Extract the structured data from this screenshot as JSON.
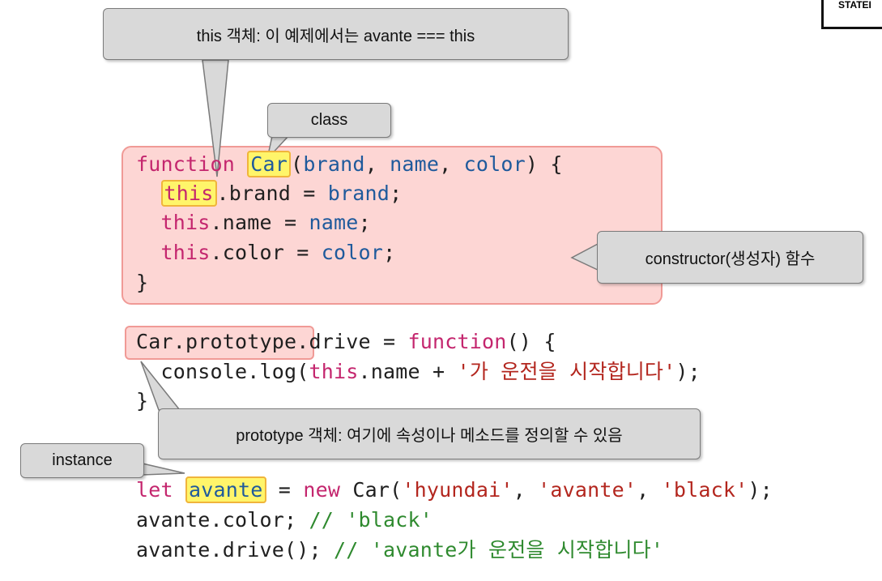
{
  "callouts": {
    "this_object": "this 객체: 이 예제에서는 avante === this",
    "class": "class",
    "constructor": "constructor(생성자) 함수",
    "prototype_object": "prototype 객체: 여기에 속성이나 메소드를 정의할 수 있음",
    "instance": "instance"
  },
  "corner_label": "STATEI",
  "code": {
    "line1": {
      "kw": "function",
      "name": "Car",
      "rest": "(",
      "p1": "brand",
      "c1": ", ",
      "p2": "name",
      "c2": ", ",
      "p3": "color",
      "end": ") {"
    },
    "line2": {
      "this": "this",
      "rest": ".brand = ",
      "val": "brand",
      "end": ";"
    },
    "line3": {
      "this": "this",
      "rest": ".name = ",
      "val": "name",
      "end": ";"
    },
    "line4": {
      "this": "this",
      "rest": ".color = ",
      "val": "color",
      "end": ";"
    },
    "line5": {
      "text": "}"
    },
    "line6": {
      "obj": "Car.prototype",
      "rest": ".drive = ",
      "kw": "function",
      "end": "() {"
    },
    "line7": {
      "pre": "  console.log(",
      "this": "this",
      "rest": ".name + ",
      "str": "'가 운전을 시작합니다'",
      "end": ");"
    },
    "line8": {
      "text": "}"
    },
    "line9": {
      "kw": "let",
      "var": "avante",
      "eq": " = ",
      "kw2": "new",
      "cls": " Car(",
      "s1": "'hyundai'",
      "c1": ", ",
      "s2": "'avante'",
      "c2": ", ",
      "s3": "'black'",
      "end": ");"
    },
    "line10": {
      "text": "avante.color; ",
      "comment": "// 'black'"
    },
    "line11": {
      "text": "avante.drive(); ",
      "comment": "// 'avante가 운전을 시작합니다'"
    }
  }
}
